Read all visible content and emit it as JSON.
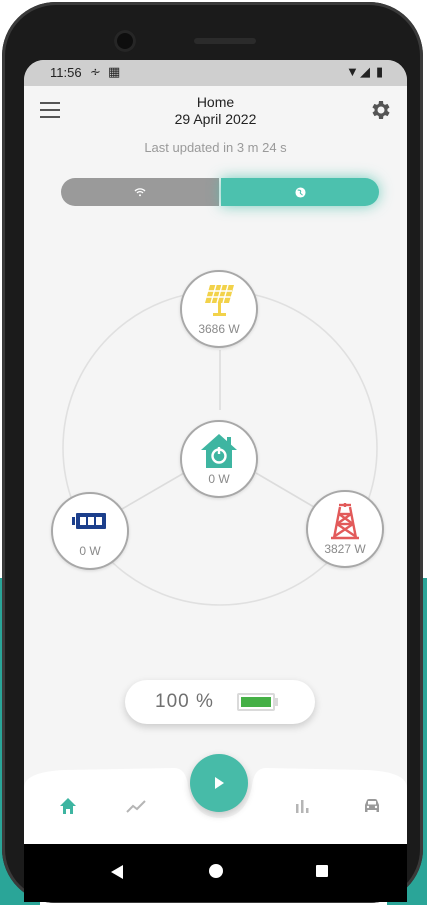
{
  "status_bar": {
    "time": "11:56",
    "icons": [
      "data-saver-icon",
      "sd-card-icon",
      "wifi-icon",
      "signal-icon",
      "battery-icon"
    ]
  },
  "header": {
    "title": "Home",
    "date": "29 April 2022",
    "last_updated": "Last updated in 3 m 24 s",
    "menu_icon": "hamburger-menu-icon",
    "settings_icon": "gear-icon"
  },
  "connection_toggle": {
    "options": [
      {
        "icon": "wifi-icon",
        "selected": false
      },
      {
        "icon": "globe-icon",
        "selected": true
      }
    ]
  },
  "energy_flow": {
    "solar": {
      "value": "3686 W",
      "icon": "solar-panel-icon"
    },
    "home": {
      "value": "0 W",
      "icon": "home-icon"
    },
    "battery": {
      "value": "0 W",
      "icon": "battery-icon"
    },
    "grid": {
      "value": "3827 W",
      "icon": "power-tower-icon"
    }
  },
  "battery_status": {
    "percent_label": "100 %",
    "level": 1.0
  },
  "bottom_nav": {
    "items": [
      {
        "icon": "home-icon",
        "active": true
      },
      {
        "icon": "trend-chart-icon",
        "active": false
      },
      {
        "icon": "play-icon",
        "active": false
      },
      {
        "icon": "bar-chart-icon",
        "active": false
      },
      {
        "icon": "car-icon",
        "active": false
      }
    ]
  },
  "colors": {
    "accent": "#47bba8",
    "solar": "#f2d24a",
    "battery": "#1c3f8c",
    "grid": "#e25a5a",
    "battery_fill": "#45b046"
  }
}
